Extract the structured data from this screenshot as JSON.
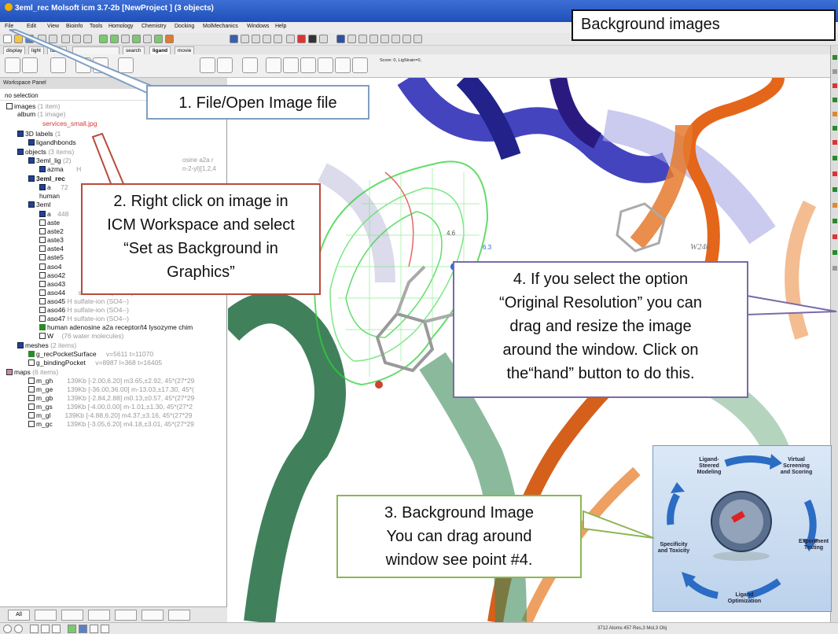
{
  "window": {
    "title": "3eml_rec Molsoft icm 3.7-2b  [NewProject ] (3 objects)"
  },
  "menu": [
    "File",
    "Edit",
    "View",
    "Bioinfo",
    "Tools",
    "Homology",
    "Chemistry",
    "Docking",
    "MolMechanics",
    "Windows",
    "Help"
  ],
  "tabs": [
    "display",
    "light",
    "labels",
    "",
    "search",
    "ligand",
    "movie"
  ],
  "score_text": "Score: 0, LigStrain=0,",
  "workspace": {
    "header": "Workspace Panel",
    "selection": "no selection",
    "tree": [
      {
        "name": "images",
        "info": "(1 item)",
        "bold": false
      },
      {
        "name": "album",
        "info": "(1 image)",
        "bold": false
      },
      {
        "name": "services_small.jpg",
        "info": "",
        "bold": false
      },
      {
        "name": "3D labels",
        "info": "(1",
        "bold": false
      },
      {
        "name": "ligandhbonds",
        "info": "",
        "bold": false
      },
      {
        "name": "objects",
        "info": "(3 items)",
        "bold": false
      },
      {
        "name": "3eml_lig",
        "info": "(2)",
        "bold": false
      },
      {
        "name": "azma",
        "info": "H",
        "bold": false
      },
      {
        "name": "3eml_rec",
        "info": "",
        "bold": true
      },
      {
        "name": "a",
        "info": "72",
        "bold": false
      },
      {
        "name": "human",
        "info": "",
        "bold": false
      },
      {
        "name": "3eml",
        "info": "",
        "bold": false
      },
      {
        "name": "a",
        "info": "448",
        "bold": false
      },
      {
        "name": "aste",
        "info": "",
        "bold": false
      },
      {
        "name": "aste2",
        "info": "",
        "bold": false
      },
      {
        "name": "aste3",
        "info": "",
        "bold": false
      },
      {
        "name": "aste4",
        "info": "",
        "bold": false
      },
      {
        "name": "aste5",
        "info": "",
        "bold": false
      },
      {
        "name": "aso4",
        "info": "",
        "bold": false
      },
      {
        "name": "aso42",
        "info": "",
        "bold": false
      },
      {
        "name": "aso43",
        "info": "",
        "bold": false
      },
      {
        "name": "aso44",
        "info": "sulfate-ion (SO4--)",
        "bold": false
      },
      {
        "name": "aso45",
        "info": "H  sulfate-ion (SO4--)",
        "bold": false
      },
      {
        "name": "aso46",
        "info": "H  sulfate-ion (SO4--)",
        "bold": false
      },
      {
        "name": "aso47",
        "info": "H  sulfate-ion (SO4--)",
        "bold": false
      },
      {
        "name": "human adenosine a2a receptor/t4 lysozyme chim",
        "info": "",
        "bold": false
      },
      {
        "name": "W",
        "info": "(76 water molecules)",
        "bold": false
      },
      {
        "name": "meshes",
        "info": "(2 items)",
        "bold": false
      },
      {
        "name": "g_recPocketSurface",
        "info": "v=5611 t=11070",
        "bold": false
      },
      {
        "name": "g_bindingPocket",
        "info": "v=8987 l=368 t=16405",
        "bold": false
      },
      {
        "name": "maps",
        "info": "(6 items)",
        "bold": false
      },
      {
        "name": "m_gh",
        "info": "139Kb [-2.00,6.20] m3.65,±2.92, 45*(27*29",
        "bold": false
      },
      {
        "name": "m_ge",
        "info": "139Kb [-36.00,36.00] m-13.03,±17.30, 45*(",
        "bold": false
      },
      {
        "name": "m_gb",
        "info": "139Kb [-2.84,2.88] m0.13,±0.57, 45*(27*29",
        "bold": false
      },
      {
        "name": "m_gs",
        "info": "139Kb [-4.00,0.00] m-1.01,±1.30, 45*(27*2",
        "bold": false
      },
      {
        "name": "m_gl",
        "info": "139Kb [-4.88,6.20] m4.37,±3.16, 45*(27*29",
        "bold": false
      },
      {
        "name": "m_gc",
        "info": "139Kb [-3.05,6.20] m4.18,±3.01, 45*(27*29",
        "bold": false
      }
    ],
    "inline_fragments": [
      "osine a2a r",
      "n-2-yl)[1,2,4"
    ]
  },
  "panel_buttons": [
    "All"
  ],
  "status_text": "3712 Atoms 457 Res,3 Mol,3 Obj",
  "graphics": {
    "labels": {
      "w246": "W246",
      "d1": "4.6",
      "d2": "6.3"
    }
  },
  "annotations": {
    "title": "Background images",
    "step1": "1. File/Open Image file",
    "step2": [
      "2. Right click on image in",
      "ICM Workspace and select",
      "“Set as Background in",
      "Graphics”"
    ],
    "step3": [
      "3. Background Image",
      "You can drag around",
      "window see point #4."
    ],
    "step4": [
      "4. If you select the option",
      "“Original Resolution” you can",
      "drag and resize the image",
      "around the window. Click on",
      "the“hand” button to do this."
    ]
  },
  "background_image": {
    "labels": [
      "Ligand-",
      "Steered",
      "Modeling",
      "Virtual",
      "Screening",
      "and Scoring",
      "Experiment",
      "Testing",
      "Ligand",
      "Optimization",
      "Specificity",
      "and Toxicity"
    ]
  },
  "colors": {
    "titlebar": "#1f4fb8",
    "step1_border": "#7f9fc2",
    "step2_border": "#b84b3c",
    "step3_border": "#8db653",
    "step4_border": "#7a6aa8",
    "mesh_green": "#2fd13a"
  }
}
